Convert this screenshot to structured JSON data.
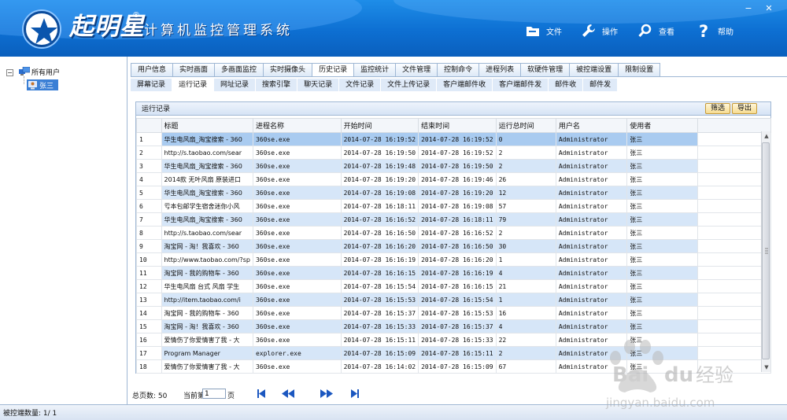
{
  "app": {
    "brand": "起明星",
    "brand_mark": "®",
    "subtitle": "计算机监控管理系统"
  },
  "toolbar": [
    {
      "label": "文件",
      "icon": "folder-icon"
    },
    {
      "label": "操作",
      "icon": "wrench-icon"
    },
    {
      "label": "查看",
      "icon": "search-icon"
    },
    {
      "label": "帮助",
      "icon": "help-icon"
    }
  ],
  "window_controls": {
    "minimize": "−",
    "close": "✕"
  },
  "tree": {
    "root": "所有用户",
    "collapse": "−",
    "child": "张三"
  },
  "tabs": [
    {
      "label": "用户信息"
    },
    {
      "label": "实时画面"
    },
    {
      "label": "多画面监控"
    },
    {
      "label": "实时摄像头"
    },
    {
      "label": "历史记录",
      "active": true
    },
    {
      "label": "监控统计"
    },
    {
      "label": "文件管理"
    },
    {
      "label": "控制命令"
    },
    {
      "label": "进程列表"
    },
    {
      "label": "软硬件管理"
    },
    {
      "label": "被控端设置"
    },
    {
      "label": "限制设置"
    }
  ],
  "subtabs": [
    {
      "label": "屏幕记录"
    },
    {
      "label": "运行记录",
      "active": true
    },
    {
      "label": "网址记录"
    },
    {
      "label": "搜索引擎"
    },
    {
      "label": "聊天记录"
    },
    {
      "label": "文件记录"
    },
    {
      "label": "文件上传记录"
    },
    {
      "label": "客户端邮件收"
    },
    {
      "label": "客户端邮件发"
    },
    {
      "label": "邮件收"
    },
    {
      "label": "邮件发"
    }
  ],
  "panel": {
    "title": "运行记录",
    "filter_label": "筛选",
    "export_label": "导出"
  },
  "grid": {
    "headers": [
      "",
      "标题",
      "进程名称",
      "开始时间",
      "结束时间",
      "运行总时间",
      "用户名",
      "使用者"
    ],
    "rows": [
      [
        "1",
        "华生电风扇_淘宝搜索 - 360",
        "360se.exe",
        "2014-07-28 16:19:52",
        "2014-07-28 16:19:52",
        "0",
        "Administrator",
        "张三"
      ],
      [
        "2",
        "http://s.taobao.com/sear",
        "360se.exe",
        "2014-07-28 16:19:50",
        "2014-07-28 16:19:52",
        "2",
        "Administrator",
        "张三"
      ],
      [
        "3",
        "华生电风扇_淘宝搜索 - 360",
        "360se.exe",
        "2014-07-28 16:19:48",
        "2014-07-28 16:19:50",
        "2",
        "Administrator",
        "张三"
      ],
      [
        "4",
        "2014款 无叶风扇 原装进口",
        "360se.exe",
        "2014-07-28 16:19:20",
        "2014-07-28 16:19:46",
        "26",
        "Administrator",
        "张三"
      ],
      [
        "5",
        "华生电风扇_淘宝搜索 - 360",
        "360se.exe",
        "2014-07-28 16:19:08",
        "2014-07-28 16:19:20",
        "12",
        "Administrator",
        "张三"
      ],
      [
        "6",
        "亏本包邮学生宿舍迷你小风",
        "360se.exe",
        "2014-07-28 16:18:11",
        "2014-07-28 16:19:08",
        "57",
        "Administrator",
        "张三"
      ],
      [
        "7",
        "华生电风扇_淘宝搜索 - 360",
        "360se.exe",
        "2014-07-28 16:16:52",
        "2014-07-28 16:18:11",
        "79",
        "Administrator",
        "张三"
      ],
      [
        "8",
        "http://s.taobao.com/sear",
        "360se.exe",
        "2014-07-28 16:16:50",
        "2014-07-28 16:16:52",
        "2",
        "Administrator",
        "张三"
      ],
      [
        "9",
        "淘宝网 - 淘！我喜欢 - 360",
        "360se.exe",
        "2014-07-28 16:16:20",
        "2014-07-28 16:16:50",
        "30",
        "Administrator",
        "张三"
      ],
      [
        "10",
        "http://www.taobao.com/?sp",
        "360se.exe",
        "2014-07-28 16:16:19",
        "2014-07-28 16:16:20",
        "1",
        "Administrator",
        "张三"
      ],
      [
        "11",
        "淘宝网 - 我的购物车 - 360",
        "360se.exe",
        "2014-07-28 16:16:15",
        "2014-07-28 16:16:19",
        "4",
        "Administrator",
        "张三"
      ],
      [
        "12",
        "华生电风扇 台式 风扇 学生",
        "360se.exe",
        "2014-07-28 16:15:54",
        "2014-07-28 16:16:15",
        "21",
        "Administrator",
        "张三"
      ],
      [
        "13",
        "http://item.taobao.com/i",
        "360se.exe",
        "2014-07-28 16:15:53",
        "2014-07-28 16:15:54",
        "1",
        "Administrator",
        "张三"
      ],
      [
        "14",
        "淘宝网 - 我的购物车 - 360",
        "360se.exe",
        "2014-07-28 16:15:37",
        "2014-07-28 16:15:53",
        "16",
        "Administrator",
        "张三"
      ],
      [
        "15",
        "淘宝网 - 淘！我喜欢 - 360",
        "360se.exe",
        "2014-07-28 16:15:33",
        "2014-07-28 16:15:37",
        "4",
        "Administrator",
        "张三"
      ],
      [
        "16",
        "爱情伤了你爱情害了我 - 大",
        "360se.exe",
        "2014-07-28 16:15:11",
        "2014-07-28 16:15:33",
        "22",
        "Administrator",
        "张三"
      ],
      [
        "17",
        "Program Manager",
        "explorer.exe",
        "2014-07-28 16:15:09",
        "2014-07-28 16:15:11",
        "2",
        "Administrator",
        "张三"
      ],
      [
        "18",
        "爱情伤了你爱情害了我 - 大",
        "360se.exe",
        "2014-07-28 16:14:02",
        "2014-07-28 16:15:09",
        "67",
        "Administrator",
        "张三"
      ]
    ],
    "selected_row": 0
  },
  "pager": {
    "total_label": "总页数: 50",
    "current_label": "当前第",
    "current_value": "1",
    "page_suffix": "页"
  },
  "status": {
    "text": "被控端数量:  1/ 1"
  },
  "watermark": {
    "brand": "Bai",
    "brand2": "du",
    "cn": "经验",
    "url": "jingyan.baidu.com"
  }
}
